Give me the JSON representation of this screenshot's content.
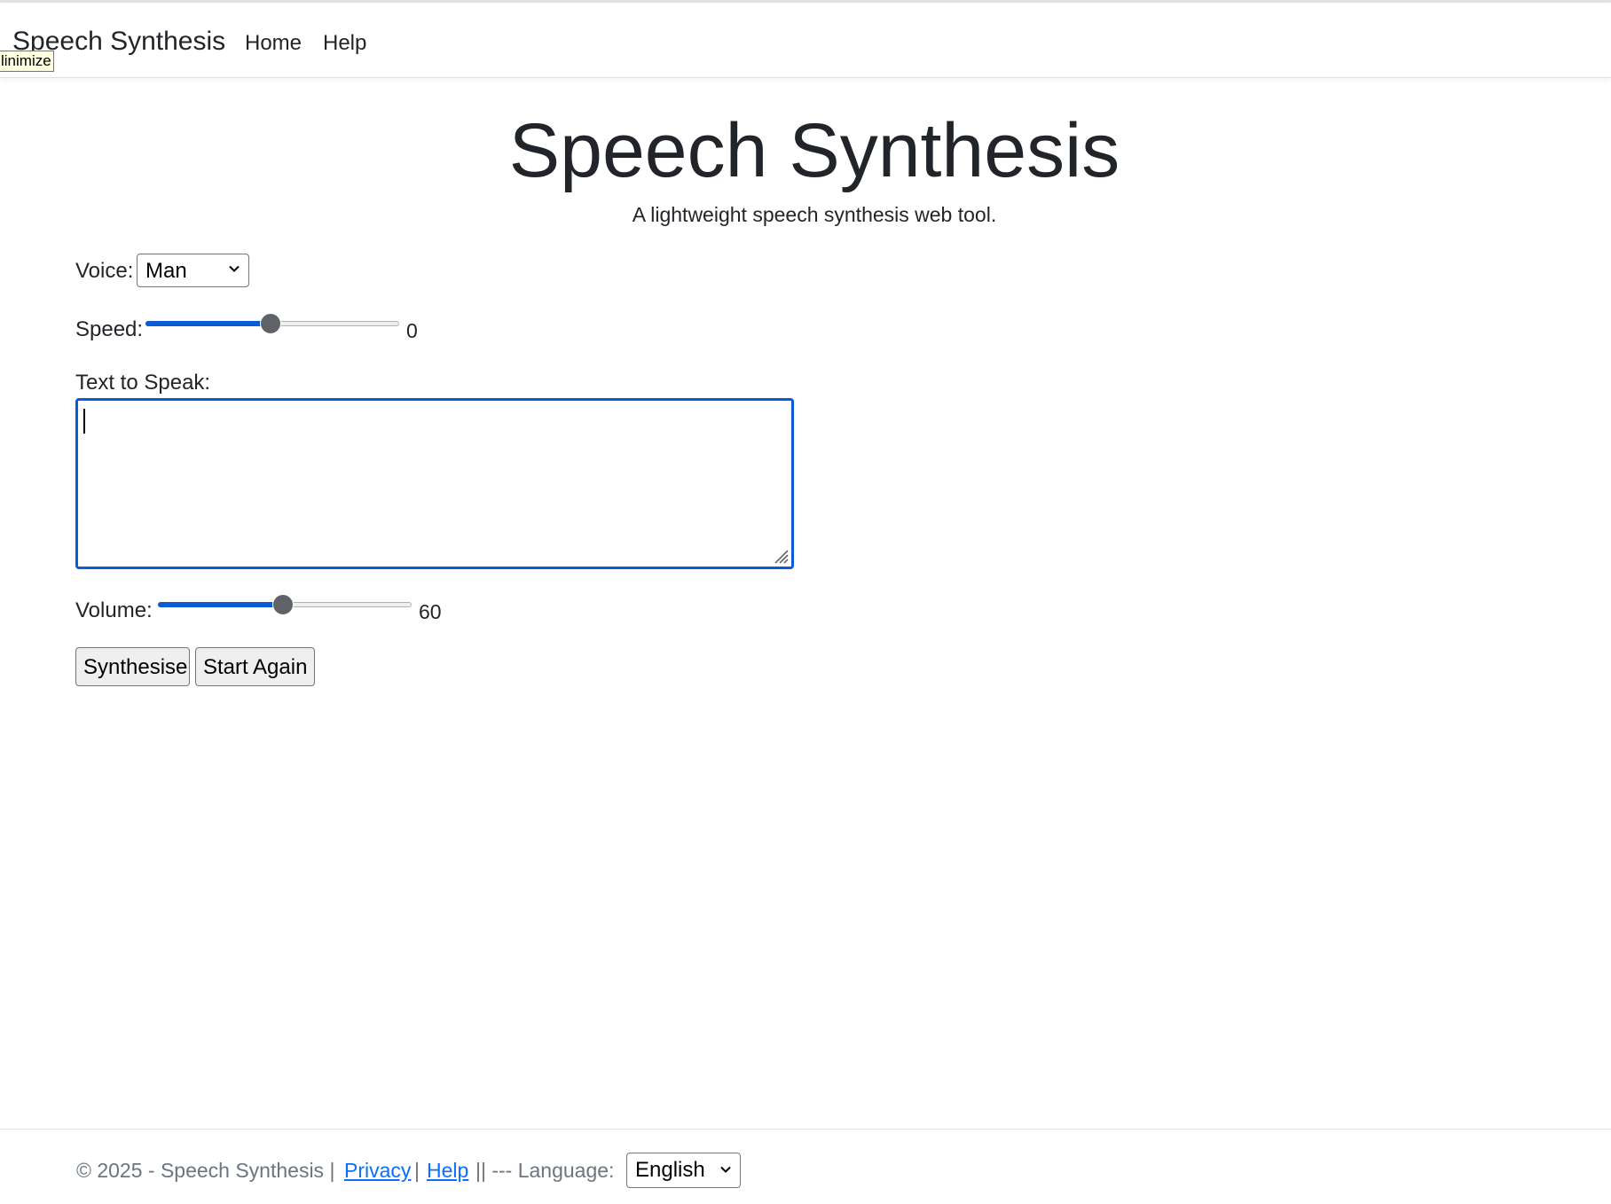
{
  "nav": {
    "brand": "Speech Synthesis",
    "links": [
      {
        "label": "Home"
      },
      {
        "label": "Help"
      }
    ],
    "tooltip": "linimize"
  },
  "hero": {
    "title": "Speech Synthesis",
    "subtitle": "A lightweight speech synthesis web tool."
  },
  "form": {
    "voice": {
      "label": "Voice:",
      "selected": "Man",
      "icon": "chevron-down-icon"
    },
    "speed": {
      "label": "Speed:",
      "value_text": "0",
      "fraction": 0.5
    },
    "text": {
      "label": "Text to Speak:",
      "value": ""
    },
    "volume": {
      "label": "Volume:",
      "value_text": "60",
      "fraction": 0.5
    },
    "buttons": {
      "synthesise": "Synthesise",
      "start_again": "Start Again"
    }
  },
  "footer": {
    "copyright": "© 2025 - Speech Synthesis |",
    "privacy": "Privacy",
    "sep1": "|",
    "help": "Help",
    "sep2": "|| --- Language:",
    "language": "English"
  },
  "colors": {
    "accent": "#0a5bd6",
    "link": "#0d6efd",
    "muted": "#6c757d",
    "text": "#212529"
  }
}
